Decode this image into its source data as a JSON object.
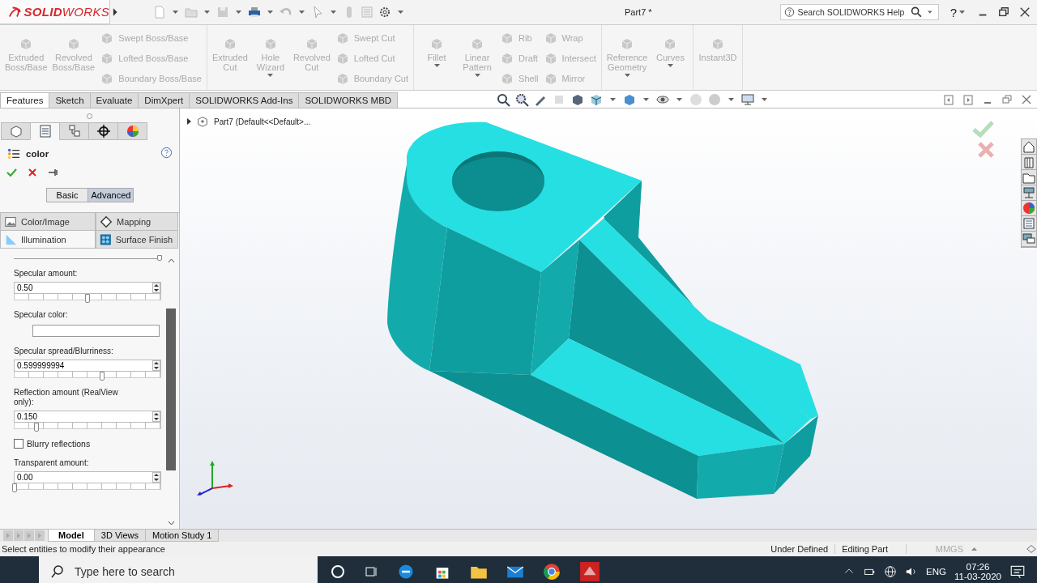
{
  "title_bar": {
    "logo": "**SOLID**WORKS",
    "title": "Part7 *",
    "help_search": {
      "placeholder": "Search SOLIDWORKS Help"
    },
    "help": "?"
  },
  "ribbon": {
    "disabled": true,
    "groups": [
      [
        {
          "kind": "large",
          "label": "Extruded Boss/Base",
          "dropdown": false
        },
        {
          "kind": "large",
          "label": "Revolved Boss/Base",
          "dropdown": false
        },
        {
          "kind": "stack",
          "items": [
            "Swept Boss/Base",
            "Lofted Boss/Base",
            "Boundary Boss/Base"
          ]
        }
      ],
      [
        {
          "kind": "large",
          "label": "Extruded Cut",
          "dropdown": false
        },
        {
          "kind": "large",
          "label": "Hole Wizard",
          "dropdown": true
        },
        {
          "kind": "large",
          "label": "Revolved Cut",
          "dropdown": false
        },
        {
          "kind": "stack",
          "items": [
            "Swept Cut",
            "Lofted Cut",
            "Boundary Cut"
          ]
        }
      ],
      [
        {
          "kind": "large",
          "label": "Fillet",
          "dropdown": true
        },
        {
          "kind": "large",
          "label": "Linear Pattern",
          "dropdown": true
        },
        {
          "kind": "stack",
          "items": [
            "Rib",
            "Draft",
            "Shell"
          ]
        },
        {
          "kind": "stack",
          "items": [
            "Wrap",
            "Intersect",
            "Mirror"
          ]
        }
      ],
      [
        {
          "kind": "large",
          "label": "Reference Geometry",
          "dropdown": true
        },
        {
          "kind": "large",
          "label": "Curves",
          "dropdown": true
        }
      ],
      [
        {
          "kind": "large",
          "label": "Instant3D",
          "dropdown": false
        }
      ]
    ]
  },
  "command_tabs": [
    {
      "label": "Features",
      "selected": true
    },
    {
      "label": "Sketch",
      "selected": false
    },
    {
      "label": "Evaluate",
      "selected": false
    },
    {
      "label": "DimXpert",
      "selected": false
    },
    {
      "label": "SOLIDWORKS Add-Ins",
      "selected": false
    },
    {
      "label": "SOLIDWORKS MBD",
      "selected": false
    }
  ],
  "property_manager": {
    "manager_tabs": [
      {
        "selected": false
      },
      {
        "selected": true
      },
      {
        "selected": false
      },
      {
        "selected": false
      },
      {
        "selected": false
      }
    ],
    "title": "color",
    "modes": [
      {
        "label": "Basic",
        "selected": false
      },
      {
        "label": "Advanced",
        "selected": true
      }
    ],
    "sub_tabs": [
      {
        "label": "Color/Image",
        "selected": false
      },
      {
        "label": "Mapping",
        "selected": false
      },
      {
        "label": "Illumination",
        "selected": true
      },
      {
        "label": "Surface Finish",
        "selected": false
      }
    ],
    "top_slider": {
      "level": 1
    },
    "properties": [
      {
        "kind": "slider",
        "label": "Specular amount:",
        "value": "0.50",
        "level": 0.5
      },
      {
        "kind": "color",
        "label": "Specular color:"
      },
      {
        "kind": "slider",
        "label": "Specular spread/Blurriness:",
        "value": "0.599999994",
        "level": 0.6
      },
      {
        "kind": "slider",
        "label": "Reflection amount (RealView only):",
        "value": "0.150",
        "level": 0.15
      },
      {
        "kind": "checkbox",
        "label": "Blurry reflections",
        "checked": false
      },
      {
        "kind": "slider",
        "label": "Transparent amount:",
        "value": "0.00",
        "level": 0
      }
    ]
  },
  "feature_tree": {
    "root": "Part7  (Default<<Default>...",
    "expanded": false
  },
  "bottom_tabs": [
    {
      "label": "Model",
      "selected": true
    },
    {
      "label": "3D Views",
      "selected": false
    },
    {
      "label": "Motion Study 1",
      "selected": false
    }
  ],
  "status_bar": {
    "message": "Select entities to modify their appearance",
    "state": "Under Defined",
    "mode": "Editing Part",
    "units": "MMGS"
  },
  "taskbar": {
    "search": {
      "placeholder": "Type here to search"
    },
    "language": "ENG",
    "time": "07:26",
    "date": "11-03-2020"
  }
}
